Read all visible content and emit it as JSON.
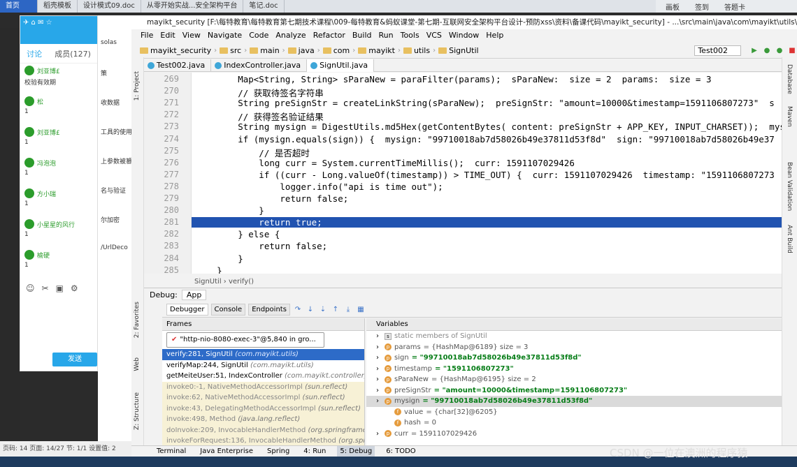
{
  "top_tabs": [
    "首页",
    "稻壳模板",
    "设计模式09.doc",
    "从零开始实战...安全架构平台",
    "笔记.doc"
  ],
  "right_strip": [
    "画板",
    "签到",
    "答题卡"
  ],
  "ide": {
    "title": "mayikt_security [F:\\每特教育\\每特教育第七期技术课程\\009-每特教育&蚂蚁课堂-第七期-互联网安全架构平台设计-预防xss\\资料\\备课代码\\mayikt_security] - ...\\src\\main\\java\\com\\mayikt\\utils\\",
    "menu": [
      "File",
      "Edit",
      "View",
      "Navigate",
      "Code",
      "Analyze",
      "Refactor",
      "Build",
      "Run",
      "Tools",
      "VCS",
      "Window",
      "Help"
    ],
    "breadcrumbs": [
      "mayikt_security",
      "src",
      "main",
      "java",
      "com",
      "mayikt",
      "utils",
      "SignUtil"
    ],
    "run_config": "Test002",
    "tabs": [
      "Test002.java",
      "IndexController.java",
      "SignUtil.java"
    ],
    "active_tab": "SignUtil.java",
    "code_lines": [
      {
        "n": "269",
        "t": "        Map<String, String> sParaNew = paraFilter(params);  sParaNew:  size = 2  params:  size = 3"
      },
      {
        "n": "270",
        "t": "        // 获取待签名字符串"
      },
      {
        "n": "271",
        "t": "        String preSignStr = createLinkString(sParaNew);  preSignStr: \"amount=10000&timestamp=1591106807273\"  s"
      },
      {
        "n": "272",
        "t": "        // 获得签名验证结果"
      },
      {
        "n": "273",
        "t": "        String mysign = DigestUtils.md5Hex(getContentBytes( content: preSignStr + APP_KEY, INPUT_CHARSET));  mys"
      },
      {
        "n": "274",
        "t": "        if (mysign.equals(sign)) {  mysign: \"99710018ab7d58026b49e37811d53f8d\"  sign: \"99710018ab7d58026b49e37"
      },
      {
        "n": "275",
        "t": "            // 是否超时"
      },
      {
        "n": "276",
        "t": "            long curr = System.currentTimeMillis();  curr: 1591107029426"
      },
      {
        "n": "277",
        "t": "            if ((curr - Long.valueOf(timestamp)) > TIME_OUT) {  curr: 1591107029426  timestamp: \"1591106807273"
      },
      {
        "n": "278",
        "t": "                logger.info(\"api is time out\");"
      },
      {
        "n": "279",
        "t": "                return false;"
      },
      {
        "n": "280",
        "t": "            }"
      },
      {
        "n": "281",
        "t": "            return true;"
      },
      {
        "n": "282",
        "t": "        } else {"
      },
      {
        "n": "283",
        "t": "            return false;"
      },
      {
        "n": "284",
        "t": "        }"
      },
      {
        "n": "285",
        "t": "    }"
      }
    ],
    "highlight_line": "281",
    "editor_status": "SignUtil  ›  verify()",
    "debug": {
      "label": "Debug:",
      "config": "App",
      "tabs": [
        "Debugger",
        "Console",
        "Endpoints"
      ],
      "frames_title": "Frames",
      "thread": "\"http-nio-8080-exec-3\"@5,840 in gro...",
      "frames": [
        {
          "m": "verify:281, SignUtil",
          "p": "(com.mayikt.utils)",
          "state": "sel"
        },
        {
          "m": "verifyMap:244, SignUtil",
          "p": "(com.mayikt.utils)",
          "state": "normal"
        },
        {
          "m": "getMeiteUser:51, IndexController",
          "p": "(com.mayikt.controller)",
          "state": "normal"
        },
        {
          "m": "invoke0:-1, NativeMethodAccessorImpl",
          "p": "(sun.reflect)",
          "state": "lib"
        },
        {
          "m": "invoke:62, NativeMethodAccessorImpl",
          "p": "(sun.reflect)",
          "state": "lib"
        },
        {
          "m": "invoke:43, DelegatingMethodAccessorImpl",
          "p": "(sun.reflect)",
          "state": "lib"
        },
        {
          "m": "invoke:498, Method",
          "p": "(java.lang.reflect)",
          "state": "lib"
        },
        {
          "m": "doInvoke:209, InvocableHandlerMethod",
          "p": "(org.springframewo",
          "state": "lib"
        },
        {
          "m": "invokeForRequest:136, InvocableHandlerMethod",
          "p": "(org.spring",
          "state": "lib"
        }
      ],
      "vars_title": "Variables",
      "variables": [
        {
          "ind": 0,
          "ico": "s",
          "name": "static members of SignUtil",
          "val": "",
          "kind": "gray"
        },
        {
          "ind": 0,
          "ico": "p",
          "name": "params",
          "val": "= {HashMap@6189}  size = 3",
          "kind": "plain"
        },
        {
          "ind": 0,
          "ico": "p",
          "name": "sign",
          "val": "= \"99710018ab7d58026b49e37811d53f8d\"",
          "kind": "str"
        },
        {
          "ind": 0,
          "ico": "p",
          "name": "timestamp",
          "val": "= \"1591106807273\"",
          "kind": "str"
        },
        {
          "ind": 0,
          "ico": "p",
          "name": "sParaNew",
          "val": "= {HashMap@6195}  size = 2",
          "kind": "plain"
        },
        {
          "ind": 0,
          "ico": "p",
          "name": "preSignStr",
          "val": "= \"amount=10000&timestamp=1591106807273\"",
          "kind": "str"
        },
        {
          "ind": 0,
          "ico": "p",
          "name": "mysign",
          "val": "= \"99710018ab7d58026b49e37811d53f8d\"",
          "kind": "str",
          "sel": true
        },
        {
          "ind": 1,
          "ico": "f",
          "name": "value",
          "val": "= {char[32]@6205}",
          "kind": "plain"
        },
        {
          "ind": 1,
          "ico": "f",
          "name": "hash",
          "val": "= 0",
          "kind": "plain"
        },
        {
          "ind": 0,
          "ico": "p",
          "name": "curr",
          "val": "= 1591107029426",
          "kind": "plain"
        }
      ]
    },
    "bottom_tabs": [
      "Terminal",
      "Java Enterprise",
      "Spring",
      "4: Run",
      "5: Debug",
      "6: TODO"
    ],
    "active_bottom": "5: Debug",
    "left_tools": [
      "1: Project",
      "2: Favorites",
      "Web",
      "Z: Structure"
    ],
    "right_tools": [
      "Database",
      "Maven",
      "Bean Validation",
      "Ant Build"
    ]
  },
  "chat": {
    "tabs": [
      "讨论",
      "成员(127)"
    ],
    "items": [
      {
        "name": "刘亚博£",
        "msg": "校验有效期"
      },
      {
        "name": "松",
        "msg": "1"
      },
      {
        "name": "刘亚博£",
        "msg": "1"
      },
      {
        "name": "冯泡泡",
        "msg": "1"
      },
      {
        "name": "方小瑞",
        "msg": "1"
      },
      {
        "name": "小星星的风行",
        "msg": "1"
      },
      {
        "name": "榆硬",
        "msg": "1"
      }
    ],
    "send": "发送"
  },
  "behind_app": [
    "solas",
    "策",
    "收数据",
    "工具的使用",
    "上参数被篡",
    "名与验证",
    "尔加密",
    "/UrlDeco"
  ],
  "statusbar": "页码: 14  页面: 14/27  节: 1/1  设置值: 2",
  "watermark": "CSDN @一位在澳洲的程序猿"
}
